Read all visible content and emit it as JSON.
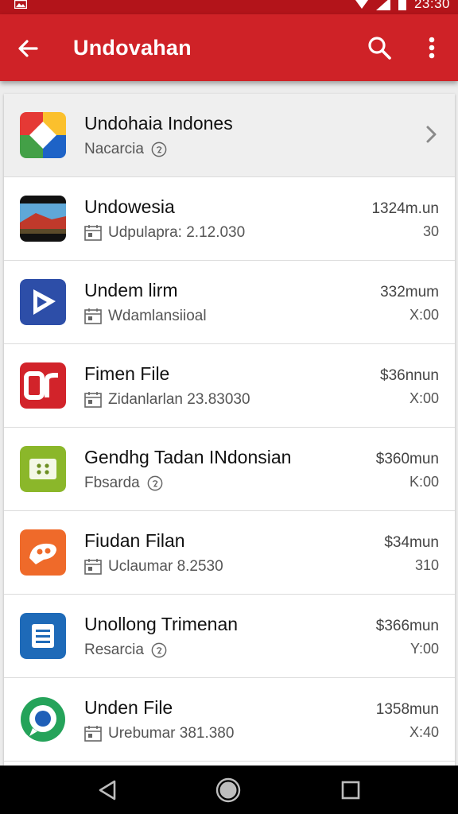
{
  "status_bar": {
    "time": "23:30"
  },
  "app_bar": {
    "title": "Undovahan"
  },
  "colors": {
    "app_bar": "#cf2227",
    "status_bar": "#b3141a"
  },
  "items": [
    {
      "name": "Undohaia Indones",
      "meta": "Nacarcia",
      "meta_icon": "info-circle-icon",
      "price": "",
      "sub": "",
      "trailing": "chevron-right-icon"
    },
    {
      "name": "Undowesia",
      "meta": "Udpulapra: 2.12.030",
      "meta_icon": "calendar-icon",
      "price": "1324m.un",
      "sub": "30"
    },
    {
      "name": "Undem lirm",
      "meta": "Wdamlansiioal",
      "meta_icon": "calendar-icon",
      "price": "332mum",
      "sub": "X:00"
    },
    {
      "name": "Fimen File",
      "meta": "Zidanlarlan 23.83030",
      "meta_icon": "calendar-icon",
      "price": "$36nnun",
      "sub": "X:00"
    },
    {
      "name": "Gendhg Tadan INdonsian",
      "meta": "Fbsarda",
      "meta_icon": "info-circle-icon",
      "price": "$360mun",
      "sub": "K:00"
    },
    {
      "name": "Fiudan Filan",
      "meta": "Uclaumar 8.2530",
      "meta_icon": "calendar-icon",
      "price": "$34mun",
      "sub": "310"
    },
    {
      "name": "Unollong Trimenan",
      "meta": "Resarcia",
      "meta_icon": "info-circle-icon",
      "price": "$366mun",
      "sub": "Y:00"
    },
    {
      "name": "Unden File",
      "meta": "Urebumar 381.380",
      "meta_icon": "calendar-icon",
      "price": "1358mun",
      "sub": "X:40"
    }
  ]
}
